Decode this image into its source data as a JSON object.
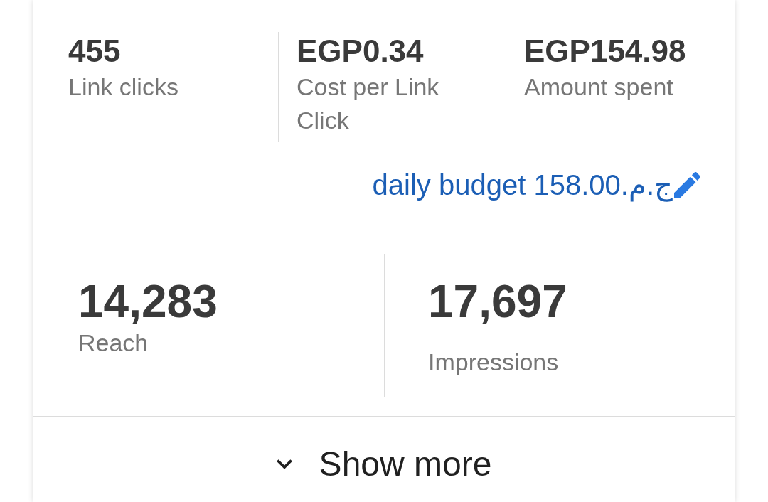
{
  "summary_metrics": [
    {
      "value": "455",
      "label": "Link clicks"
    },
    {
      "value": "EGP0.34",
      "label": "Cost per Link Click"
    },
    {
      "value": "EGP154.98",
      "label": "Amount spent"
    }
  ],
  "budget_link": {
    "text": "daily budget ج.م.158.00"
  },
  "reach_metrics": [
    {
      "value": "14,283",
      "label": "Reach"
    },
    {
      "value": "17,697",
      "label": "Impressions"
    }
  ],
  "show_more": {
    "label": "Show more"
  }
}
